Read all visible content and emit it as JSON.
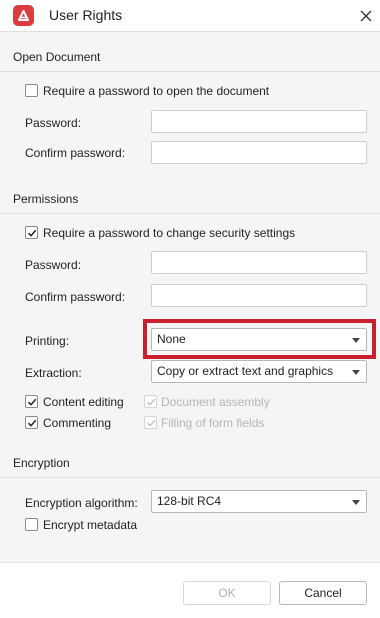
{
  "window": {
    "title": "User Rights",
    "app_icon": "pdf-app-icon",
    "close_icon": "close-icon"
  },
  "open_document": {
    "section_title": "Open Document",
    "require_password_label": "Require a password to open the document",
    "require_password_checked": false,
    "password_label": "Password:",
    "password_value": "",
    "confirm_label": "Confirm password:",
    "confirm_value": ""
  },
  "permissions": {
    "section_title": "Permissions",
    "require_password_label": "Require a password to change security settings",
    "require_password_checked": true,
    "password_label": "Password:",
    "password_value": "",
    "confirm_label": "Confirm password:",
    "confirm_value": "",
    "printing_label": "Printing:",
    "printing_value": "None",
    "extraction_label": "Extraction:",
    "extraction_value": "Copy or extract text and graphics",
    "content_editing_label": "Content editing",
    "content_editing_checked": true,
    "document_assembly_label": "Document assembly",
    "document_assembly_checked": true,
    "commenting_label": "Commenting",
    "commenting_checked": true,
    "filling_forms_label": "Filling of form fields",
    "filling_forms_checked": true
  },
  "encryption": {
    "section_title": "Encryption",
    "algorithm_label": "Encryption algorithm:",
    "algorithm_value": "128-bit RC4",
    "encrypt_metadata_label": "Encrypt metadata",
    "encrypt_metadata_checked": false
  },
  "footer": {
    "ok_label": "OK",
    "cancel_label": "Cancel"
  },
  "colors": {
    "highlight": "#c8202e",
    "app_icon": "#d93d3d"
  }
}
